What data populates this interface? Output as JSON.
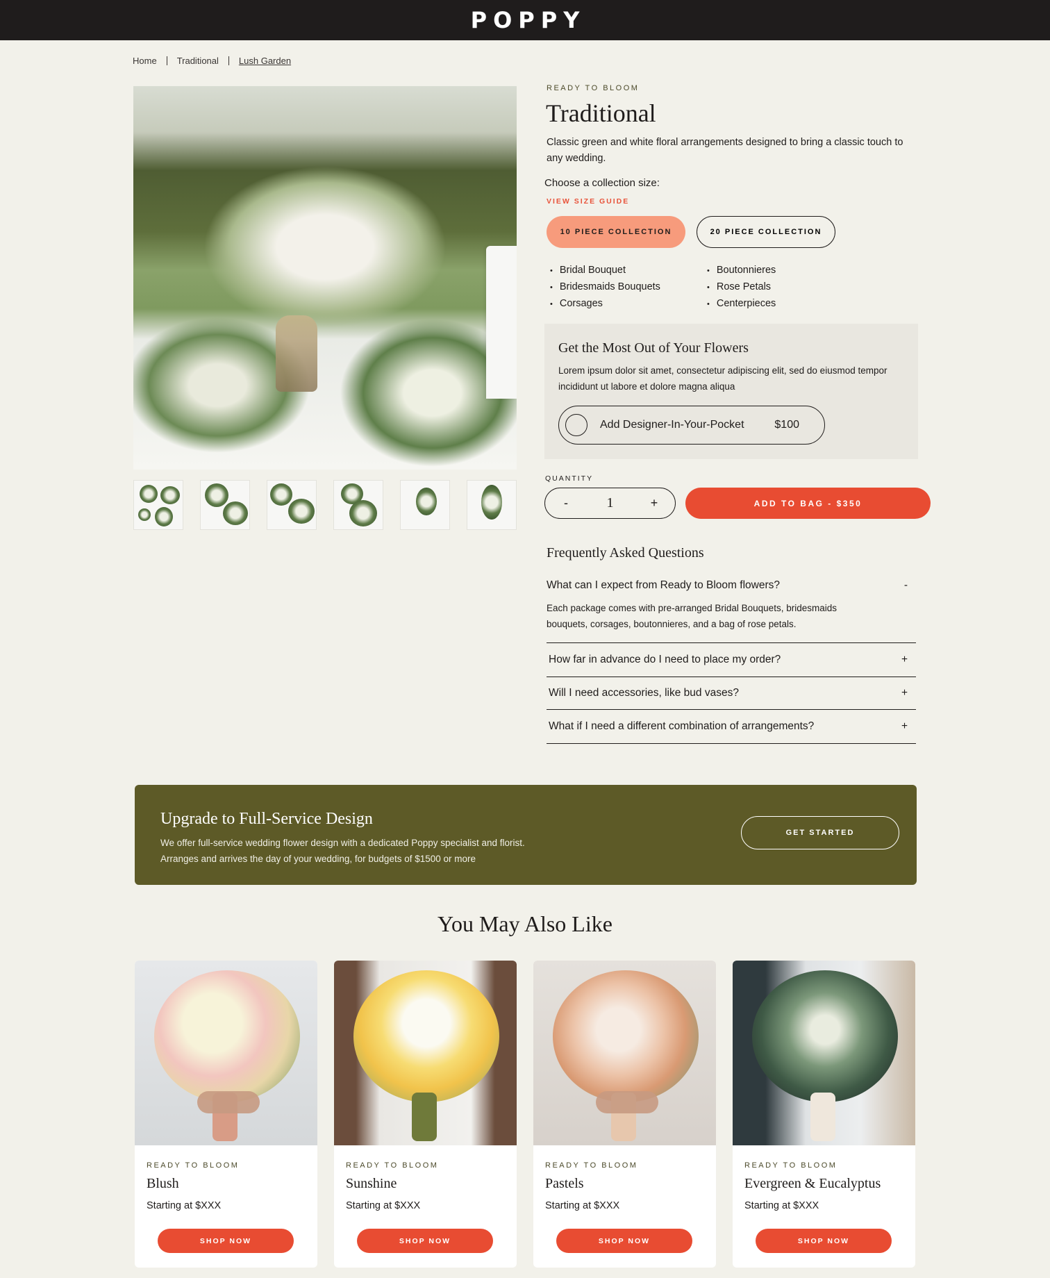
{
  "brand": {
    "logo": "POPPY"
  },
  "breadcrumb": {
    "items": [
      "Home",
      "Traditional",
      "Lush Garden"
    ]
  },
  "product": {
    "eyebrow": "READY TO BLOOM",
    "title": "Traditional",
    "description": "Classic green and white floral arrangements designed to bring a classic touch to any wedding.",
    "choose_label": "Choose a collection size:",
    "size_guide_link": "VIEW SIZE GUIDE",
    "sizes": [
      {
        "label": "10 PIECE COLLECTION",
        "selected": true
      },
      {
        "label": "20 PIECE COLLECTION",
        "selected": false
      }
    ],
    "includes_left": [
      "Bridal Bouquet",
      "Bridesmaids Bouquets",
      "Corsages"
    ],
    "includes_right": [
      "Boutonnieres",
      "Rose Petals",
      "Centerpieces"
    ],
    "image_icon": "floral-arrangement-photo",
    "thumbnail_count": 6
  },
  "addon": {
    "title": "Get the Most Out of Your Flowers",
    "description": "Lorem ipsum dolor sit amet, consectetur adipiscing elit, sed do eiusmod tempor incididunt ut labore et dolore magna aliqua",
    "option_label": "Add Designer-In-Your-Pocket",
    "option_price": "$100",
    "option_selected": false
  },
  "purchase": {
    "quantity_label": "QUANTITY",
    "decrement": "-",
    "quantity": "1",
    "increment": "+",
    "add_to_bag": "ADD TO BAG - $350"
  },
  "faq": {
    "title": "Frequently Asked Questions",
    "items": [
      {
        "question": "What can I expect from Ready to Bloom flowers?",
        "answer": "Each package comes with pre-arranged Bridal Bouquets, bridesmaids bouquets, corsages, boutonnieres, and a bag of rose petals.",
        "toggle": "-"
      },
      {
        "question": "How far in advance do I need to place my order?",
        "toggle": "+"
      },
      {
        "question": "Will I need accessories, like bud vases?",
        "toggle": "+"
      },
      {
        "question": "What if I need a different combination of arrangements?",
        "toggle": "+"
      }
    ]
  },
  "upgrade": {
    "title": "Upgrade to Full-Service Design",
    "description": "We offer full-service wedding flower design with a dedicated Poppy specialist and florist. Arranges and arrives the day of your wedding, for budgets of $1500 or more",
    "button": "GET STARTED"
  },
  "related": {
    "title": "You May Also Like",
    "cards": [
      {
        "eyebrow": "READY TO BLOOM",
        "name": "Blush",
        "price": "Starting at $XXX",
        "button": "SHOP NOW"
      },
      {
        "eyebrow": "READY TO BLOOM",
        "name": "Sunshine",
        "price": "Starting at $XXX",
        "button": "SHOP NOW"
      },
      {
        "eyebrow": "READY TO BLOOM",
        "name": "Pastels",
        "price": "Starting at $XXX",
        "button": "SHOP NOW"
      },
      {
        "eyebrow": "READY TO BLOOM",
        "name": "Evergreen & Eucalyptus",
        "price": "Starting at $XXX",
        "button": "SHOP NOW"
      }
    ]
  },
  "colors": {
    "header": "#1f1c1c",
    "background": "#f2f1ea",
    "accent": "#e84c32",
    "accent_soft": "#f79b7c",
    "banner": "#5d5a27",
    "eyebrow": "#4c4a2a"
  }
}
